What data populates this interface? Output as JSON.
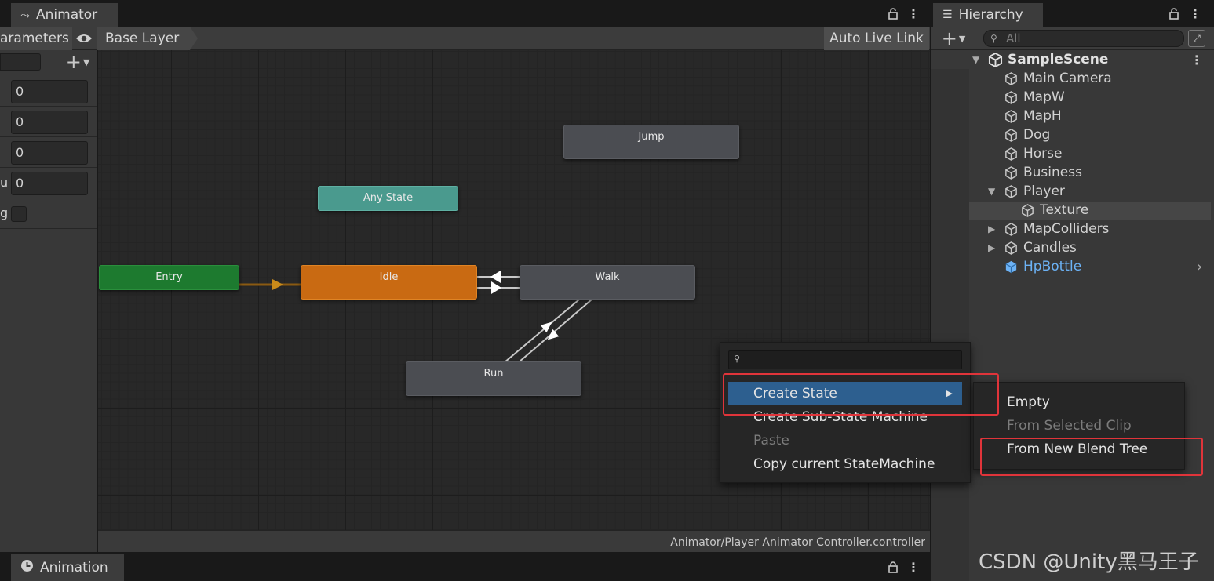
{
  "animator": {
    "tab_title": "Animator",
    "params_tab": "arameters",
    "layer_breadcrumb": "Base Layer",
    "auto_live_link": "Auto Live Link",
    "status_path": "Animator/Player Animator Controller.controller",
    "params": [
      {
        "label": "",
        "value": "0"
      },
      {
        "label": "",
        "value": "0"
      },
      {
        "label": "",
        "value": "0"
      },
      {
        "label": "u",
        "value": "0"
      },
      {
        "label": "g",
        "value": ""
      }
    ],
    "states": {
      "jump": "Jump",
      "any_state": "Any State",
      "entry": "Entry",
      "idle": "Idle",
      "walk": "Walk",
      "run": "Run"
    },
    "colors": {
      "entry": "#1d7a2f",
      "idle": "#c96a12",
      "any_state": "#4a9a8e",
      "state": "#4b4d52"
    }
  },
  "animation": {
    "tab_title": "Animation"
  },
  "hierarchy": {
    "tab_title": "Hierarchy",
    "search_placeholder": "All",
    "scene": "SampleScene",
    "items": [
      {
        "label": "Main Camera"
      },
      {
        "label": "MapW"
      },
      {
        "label": "MapH"
      },
      {
        "label": "Dog"
      },
      {
        "label": "Horse"
      },
      {
        "label": "Business"
      },
      {
        "label": "Player"
      },
      {
        "label": "Texture"
      },
      {
        "label": "MapColliders"
      },
      {
        "label": "Candles"
      },
      {
        "label": "HpBottle"
      }
    ],
    "prefab_color": "#6cb2f5"
  },
  "context_menu": {
    "items": [
      {
        "label": "Create State",
        "state": "highlighted"
      },
      {
        "label": "Create Sub-State Machine",
        "state": "normal"
      },
      {
        "label": "Paste",
        "state": "disabled"
      },
      {
        "label": "Copy current StateMachine",
        "state": "normal"
      }
    ],
    "submenu": [
      {
        "label": "Empty",
        "state": "normal"
      },
      {
        "label": "From Selected Clip",
        "state": "disabled"
      },
      {
        "label": "From New Blend Tree",
        "state": "normal"
      }
    ],
    "highlight_color": "#2d5f8f",
    "annotation_color": "#e0343a"
  },
  "watermark": "CSDN @Unity黑马王子"
}
